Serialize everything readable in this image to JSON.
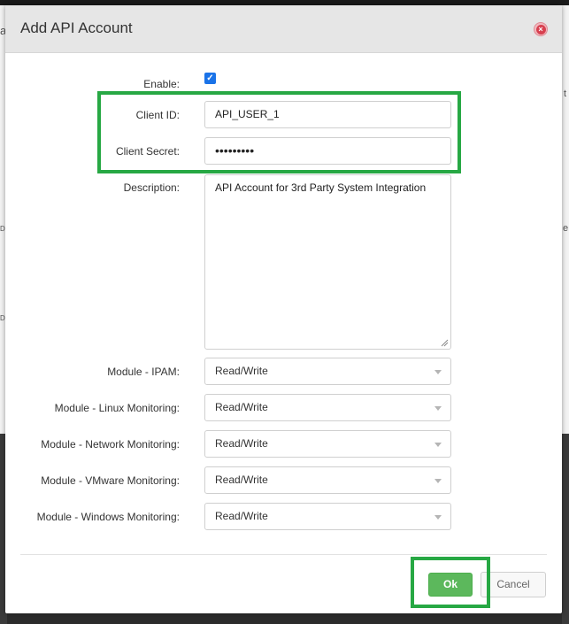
{
  "dialog": {
    "title": "Add API Account",
    "close_icon": "close-circle-icon"
  },
  "form": {
    "enable": {
      "label": "Enable:",
      "checked": true
    },
    "client_id": {
      "label": "Client ID:",
      "value": "API_USER_1"
    },
    "client_secret": {
      "label": "Client Secret:",
      "value": "•••••••••"
    },
    "description": {
      "label": "Description:",
      "value": "API Account for 3rd Party System Integration"
    },
    "modules": [
      {
        "label": "Module - IPAM:",
        "value": "Read/Write"
      },
      {
        "label": "Module - Linux Monitoring:",
        "value": "Read/Write"
      },
      {
        "label": "Module - Network Monitoring:",
        "value": "Read/Write"
      },
      {
        "label": "Module - VMware Monitoring:",
        "value": "Read/Write"
      },
      {
        "label": "Module - Windows Monitoring:",
        "value": "Read/Write"
      }
    ]
  },
  "footer": {
    "ok_label": "Ok",
    "cancel_label": "Cancel"
  },
  "background": {
    "frag_a": "a",
    "frag_t": "t",
    "frag_d1": "D",
    "frag_e": "e",
    "frag_d2": "D"
  },
  "colors": {
    "highlight": "#27a844",
    "ok_button": "#5cb85c",
    "checkbox": "#1a73e8",
    "close_icon": "#d7404f"
  }
}
